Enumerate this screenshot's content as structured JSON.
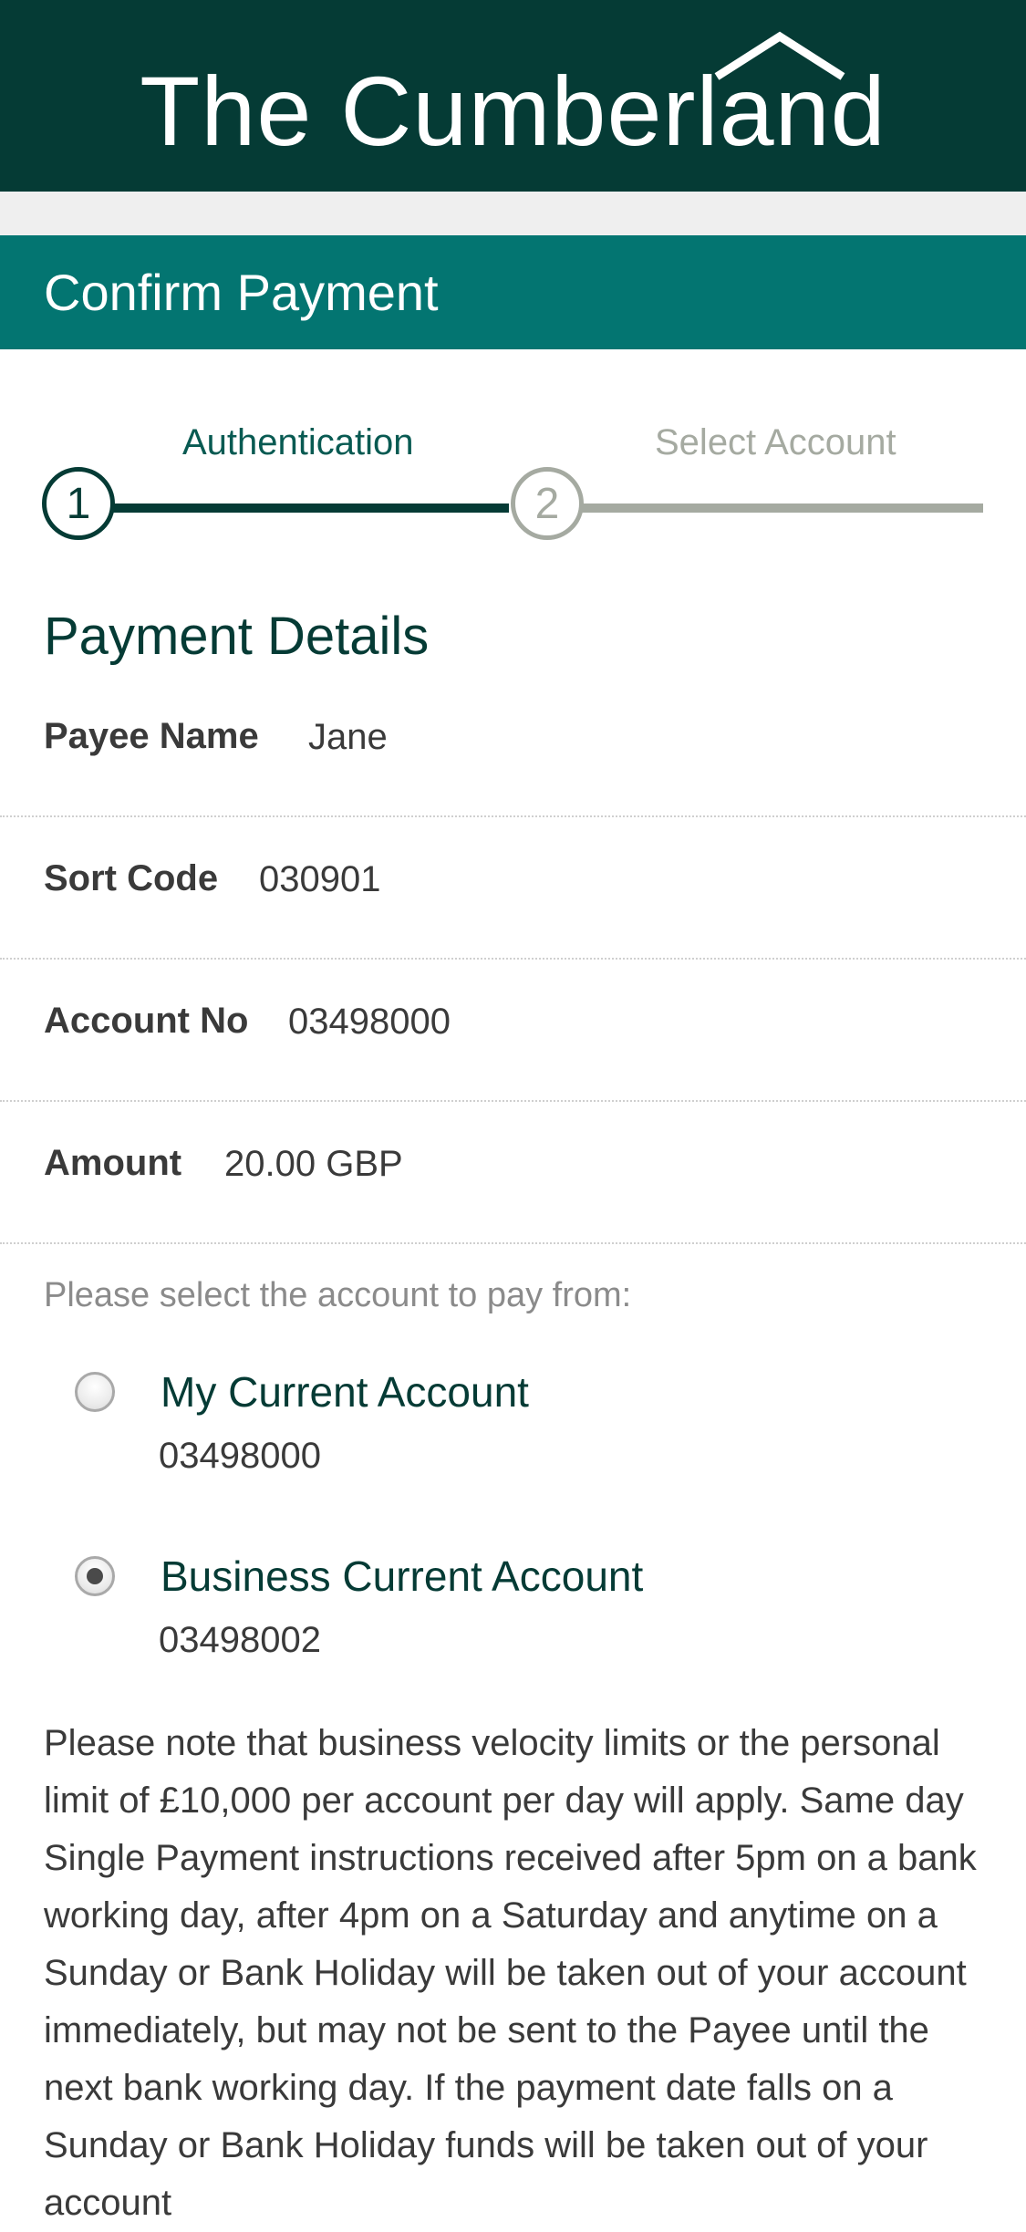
{
  "header": {
    "brand": "The Cumberland",
    "logo_icon": "roof-icon",
    "background": "#053b35"
  },
  "title_bar": {
    "title": "Confirm Payment",
    "background": "#037571"
  },
  "stepper": {
    "steps": [
      {
        "number": "1",
        "label": "Authentication",
        "state": "active"
      },
      {
        "number": "2",
        "label": "Select Account",
        "state": "inactive"
      }
    ]
  },
  "payment_details": {
    "title": "Payment Details",
    "rows": [
      {
        "label": "Payee Name",
        "value": "Jane"
      },
      {
        "label": "Sort Code",
        "value": "030901"
      },
      {
        "label": "Account No",
        "value": "03498000"
      },
      {
        "label": "Amount",
        "value": "20.00 GBP"
      }
    ]
  },
  "account_select": {
    "prompt": "Please select the account to pay from:",
    "accounts": [
      {
        "name": "My Current Account",
        "number": "03498000",
        "selected": false
      },
      {
        "name": "Business Current Account",
        "number": "03498002",
        "selected": true
      }
    ]
  },
  "note": "Please note that business velocity limits or the personal limit of £10,000 per account per day will apply. Same day Single Payment instructions received after 5pm on a bank working day, after 4pm on a Saturday and anytime on a Sunday or Bank Holiday will be taken out of your account immediately, but may not be sent to the Payee until the next bank working day. If the payment date falls on a Sunday or Bank Holiday funds will be taken out of your account"
}
